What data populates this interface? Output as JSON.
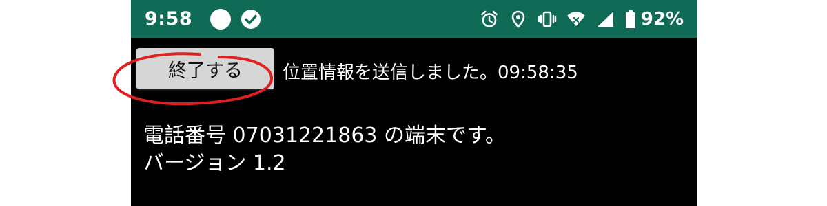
{
  "status_bar": {
    "time": "9:58",
    "battery_percent": "92%",
    "color": "#0f6b56",
    "left_icons": [
      "notification-dot-icon",
      "check-circle-icon"
    ],
    "right_icons": [
      "alarm-icon",
      "location-icon",
      "vibrate-icon",
      "wifi-icon",
      "signal-icon",
      "battery-icon"
    ]
  },
  "app": {
    "finish_button_label": "終了する",
    "sent_message": "位置情報を送信しました。09:58:35",
    "phone_line": "電話番号 07031221863 の端末です。",
    "version_line": "バージョン 1.2"
  },
  "annotation": {
    "circle_color": "#e02020"
  }
}
